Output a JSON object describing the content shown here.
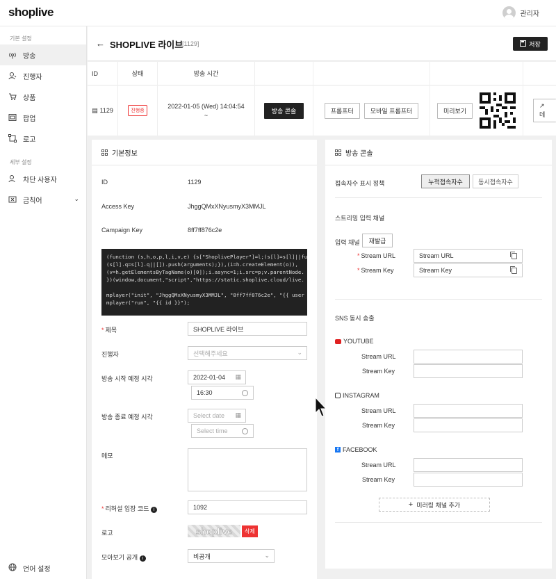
{
  "app": {
    "logo": "shoplive",
    "user_name": "관리자"
  },
  "sidebar": {
    "section_basic": "기본 설정",
    "items": [
      {
        "label": "방송",
        "icon": "broadcast-icon"
      },
      {
        "label": "진행자",
        "icon": "person-icon"
      },
      {
        "label": "상품",
        "icon": "cart-icon"
      },
      {
        "label": "팝업",
        "icon": "popup-icon"
      },
      {
        "label": "로고",
        "icon": "crop-icon"
      }
    ],
    "section_detail": "세부 설정",
    "items2": [
      {
        "label": "차단 사용자",
        "icon": "block-user-icon"
      },
      {
        "label": "금칙어",
        "icon": "forbidden-word-icon"
      }
    ],
    "language": "언어 설정"
  },
  "header": {
    "back": "←",
    "title": "SHOPLIVE 라이브",
    "id": "[1129]",
    "save": "저장"
  },
  "table": {
    "headers": {
      "id": "ID",
      "status": "상태",
      "time": "방송 시간"
    },
    "row": {
      "id": "1129",
      "status": "진행중",
      "time": "2022-01-05 (Wed) 14:04:54",
      "time2": "~",
      "console_btn": "방송 콘솔",
      "prompter": "프롬프터",
      "mobile_prompter": "모바일 프롬프터",
      "preview": "미리보기",
      "data": "데"
    }
  },
  "basic": {
    "title": "기본정보",
    "id_label": "ID",
    "id_value": "1129",
    "access_key_label": "Access Key",
    "access_key_value": "JhggQMxXNyusmyX3MMJL",
    "campaign_key_label": "Campaign Key",
    "campaign_key_value": "8ff7ff876c2e",
    "code": [
      "(function (s,h,o,p,l,i,v,e) {s[\"ShoplivePlayer\"]=l;(s[l]=s[l]||fu",
      "(s[l].q=s[l].q||[]).push(arguments);}),(i=h.createElement(o)),",
      "(v=h.getElementsByTagName(o)[0]);i.async=1;i.src=p;v.parentNode.",
      "})(window,document,\"script\",\"https://static.shoplive.cloud/live.",
      "",
      "mplayer(\"init\", \"JhggQMxXNyusmyX3MMJL\", \"8ff7ff876c2e\", \"{{ user",
      "mplayer(\"run\", \"{{ id }}\");"
    ],
    "title_label": "제목",
    "title_value": "SHOPLIVE 라이브",
    "host_label": "진행자",
    "host_placeholder": "선택해주세요",
    "start_label": "방송 시작 예정 시각",
    "start_date": "2022-01-04",
    "start_time": "16:30",
    "end_label": "방송 종료 예정 시각",
    "end_date_ph": "Select date",
    "end_time_ph": "Select time",
    "memo_label": "메모",
    "rehearsal_label": "리허설 입장 코드",
    "rehearsal_value": "1092",
    "logo_label": "로고",
    "logo_text": "shoplive",
    "delete": "삭제",
    "public_label": "모아보기 공개",
    "public_value": "비공개"
  },
  "console": {
    "title": "방송 콘솔",
    "viewer_policy": "접속자수 표시 정책",
    "cumulative": "누적접속자수",
    "concurrent": "동시접속자수",
    "stream_input": "스트리밍 입력 채널",
    "input_channel": "입력 채널",
    "reissue": "재발급",
    "stream_url": "Stream URL",
    "stream_key": "Stream Key",
    "stream_url_value": "Stream URL",
    "stream_key_value": "Stream Key",
    "sns": "SNS 동시 송출",
    "youtube": "YOUTUBE",
    "instagram": "INSTAGRAM",
    "facebook": "FACEBOOK",
    "add_mirror": "미러링 채널 추가",
    "colors": {
      "youtube": "#e02020",
      "facebook": "#1877f2"
    }
  }
}
